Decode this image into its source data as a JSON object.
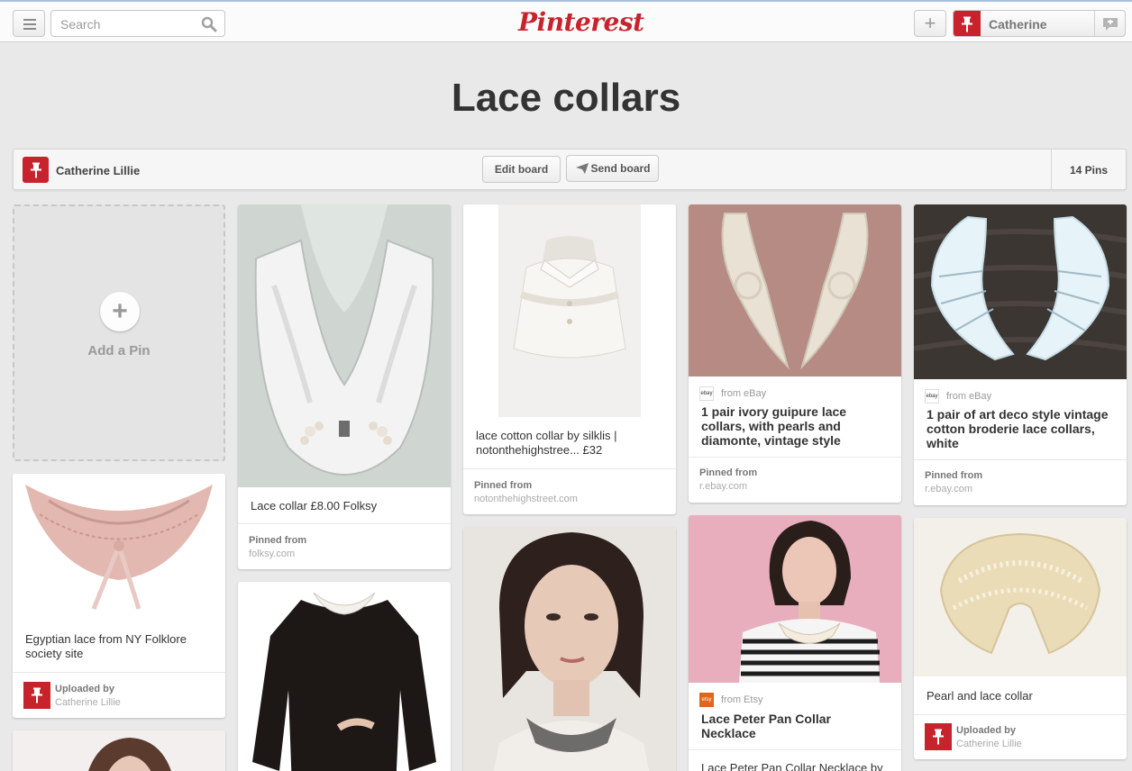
{
  "topbar": {
    "search_placeholder": "Search",
    "logo": "Pinterest",
    "user_name": "Catherine"
  },
  "board": {
    "title": "Lace collars",
    "owner": "Catherine Lillie",
    "edit_label": "Edit board",
    "send_label": "Send board",
    "pin_count": "14 Pins"
  },
  "add_pin": {
    "label": "Add a Pin"
  },
  "pins": [
    {
      "description": "Egyptian lace from NY Folklore society site",
      "source_label": "Uploaded by",
      "source": "Catherine Lillie"
    },
    {
      "description": "Lace collar £8.00 Folksy",
      "source_label": "Pinned from",
      "source": "folksy.com"
    },
    {
      "description": "lace cotton collar by silklis | notonthehighstree... £32",
      "source_label": "Pinned from",
      "source": "notonthehighstreet.com"
    },
    {
      "from": "from eBay",
      "description": "1 pair ivory guipure lace collars, with pearls and diamonte, vintage style",
      "source_label": "Pinned from",
      "source": "r.ebay.com"
    },
    {
      "from": "from Etsy",
      "description": "Lace Peter Pan Collar Necklace",
      "subtext": "Lace Peter Pan Collar Necklace by"
    },
    {
      "from": "from eBay",
      "description": "1 pair of art deco style vintage cotton broderie lace collars, white",
      "source_label": "Pinned from",
      "source": "r.ebay.com"
    },
    {
      "description": "Pearl and lace collar",
      "source_label": "Uploaded by",
      "source": "Catherine Lillie"
    }
  ],
  "colors": {
    "brand_red": "#c8232c",
    "background": "#e9e9e9"
  }
}
